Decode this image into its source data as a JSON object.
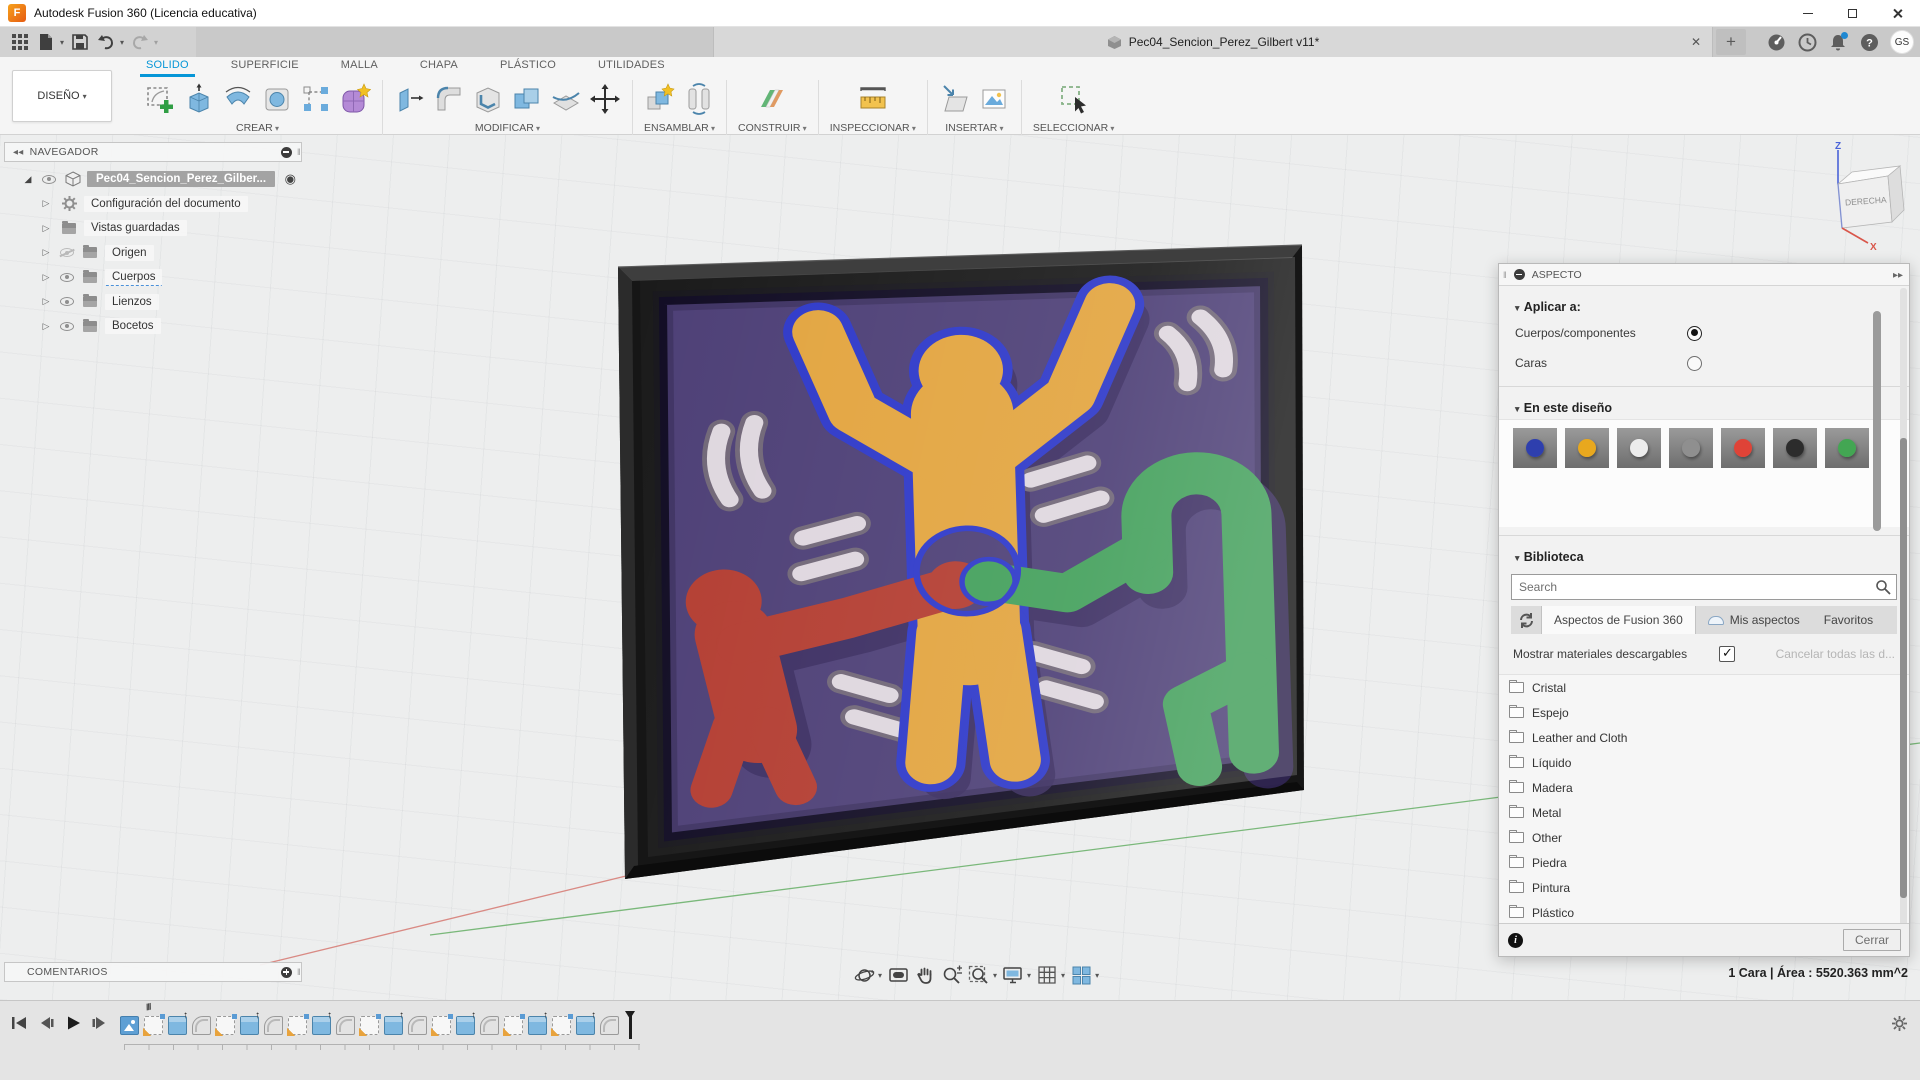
{
  "window": {
    "title": "Autodesk Fusion 360 (Licencia educativa)",
    "controls": [
      "minimize",
      "maximize",
      "close"
    ]
  },
  "app_bar": {
    "quick_access": [
      "application-menu",
      "file",
      "save",
      "undo",
      "redo"
    ],
    "document_tab": {
      "title": "Pec04_Sencion_Perez_Gilbert v11*"
    },
    "right_icons": [
      "extensions",
      "job-status",
      "notifications",
      "help"
    ],
    "avatar": "GS"
  },
  "ribbon": {
    "design_menu": "DISEÑO",
    "tabs": [
      "SOLIDO",
      "SUPERFICIE",
      "MALLA",
      "CHAPA",
      "PLÁSTICO",
      "UTILIDADES"
    ],
    "active_tab": "SOLIDO",
    "groups": [
      "CREAR",
      "MODIFICAR",
      "ENSAMBLAR",
      "CONSTRUIR",
      "INSPECCIONAR",
      "INSERTAR",
      "SELECCIONAR"
    ]
  },
  "navigator": {
    "title": "NAVEGADOR",
    "root_label": "Pec04_Sencion_Perez_Gilber...",
    "items": [
      {
        "label": "Configuración del documento"
      },
      {
        "label": "Vistas guardadas"
      },
      {
        "label": "Origen"
      },
      {
        "label": "Cuerpos"
      },
      {
        "label": "Lienzos"
      },
      {
        "label": "Bocetos"
      }
    ]
  },
  "viewcube": {
    "front_face": "DERECHA",
    "axis_z": "Z",
    "axis_x": "X"
  },
  "aspect_panel": {
    "title": "ASPECTO",
    "apply_to_label": "Aplicar a:",
    "options": [
      {
        "label": "Cuerpos/componentes",
        "selected": true
      },
      {
        "label": "Caras",
        "selected": false
      }
    ],
    "in_design_label": "En este diseño",
    "swatches": [
      "#2e3fae",
      "#e8a81e",
      "#ececec",
      "#8f8f8f",
      "#df4337",
      "#2c2c2c",
      "#43a653"
    ],
    "library": {
      "label": "Biblioteca",
      "search_placeholder": "Search",
      "tabs": [
        "Aspectos de Fusion 360",
        "Mis aspectos",
        "Favoritos"
      ],
      "active_tab": "Aspectos de Fusion 360",
      "show_downloadables_label": "Mostrar materiales descargables",
      "show_downloadables_checked": true,
      "cancel_label": "Cancelar todas las d...",
      "folders": [
        "Cristal",
        "Espejo",
        "Leather and Cloth",
        "Líquido",
        "Madera",
        "Metal",
        "Other",
        "Piedra",
        "Pintura",
        "Plástico"
      ]
    },
    "close_label": "Cerrar"
  },
  "comments_panel": {
    "title": "COMENTARIOS"
  },
  "view_toolbar": [
    "orbit",
    "look-at",
    "pan",
    "zoom",
    "fit",
    "display-settings",
    "grid-settings",
    "viewports"
  ],
  "status_bar": {
    "selection_info": "1 Cara | Área : 5520.363 mm^2"
  },
  "timeline": {
    "playback": [
      "go-to-start",
      "step-back",
      "play",
      "step-forward",
      "go-to-end"
    ],
    "features": [
      "canvas",
      "sketch",
      "extrude",
      "fillet",
      "sketch",
      "extrude",
      "fillet",
      "sketch",
      "extrude",
      "fillet",
      "sketch",
      "extrude",
      "fillet",
      "sketch",
      "extrude",
      "fillet",
      "sketch",
      "extrude",
      "sketch",
      "extrude",
      "fillet"
    ]
  },
  "canvas": {
    "colors": {
      "frame": "#161616",
      "panel": "#4a3c74",
      "figure_yellow": "#e2a33c",
      "figure_red": "#b23a2e",
      "figure_green": "#3f9e58",
      "selection_outline": "#2a35c8",
      "motion_dash": "#ded6de",
      "shadow": "#35285c",
      "axis_green": "#7ab87a",
      "axis_red": "#d98a84"
    }
  }
}
